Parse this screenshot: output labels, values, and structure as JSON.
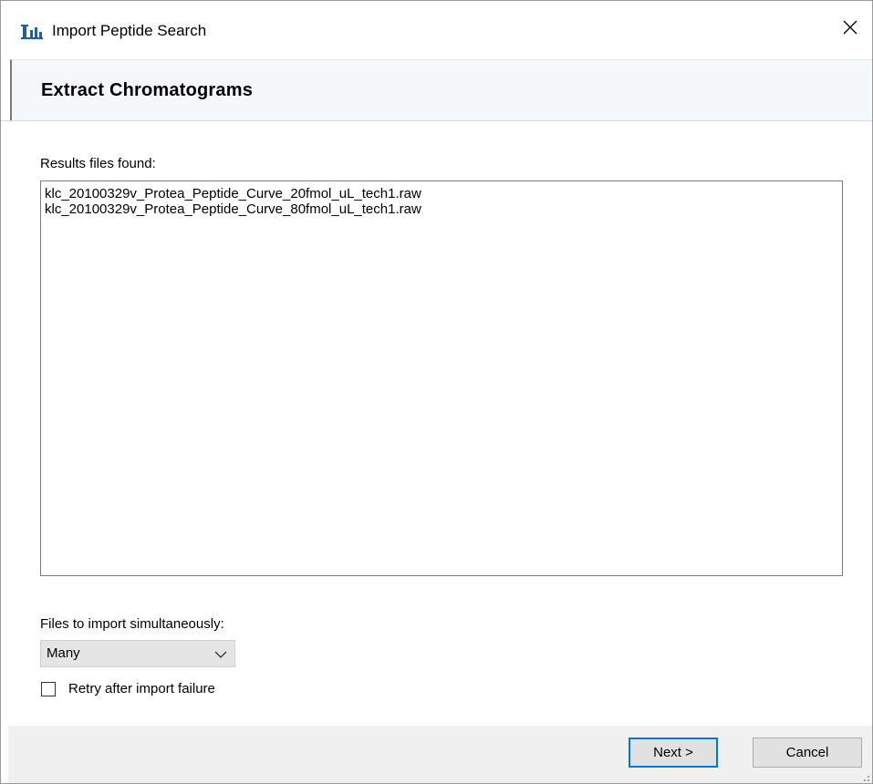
{
  "window": {
    "title": "Import Peptide Search",
    "icon": "bar-chart-app-icon",
    "close_icon": "close-icon"
  },
  "page": {
    "header_title": "Extract Chromatograms"
  },
  "results": {
    "label": "Results files found:",
    "files": [
      "klc_20100329v_Protea_Peptide_Curve_20fmol_uL_tech1.raw",
      "klc_20100329v_Protea_Peptide_Curve_80fmol_uL_tech1.raw"
    ]
  },
  "simultaneous": {
    "label": "Files to import simultaneously:",
    "selected": "Many"
  },
  "retry": {
    "label": "Retry after import failure",
    "checked": false
  },
  "buttons": {
    "next": "Next >",
    "cancel": "Cancel"
  },
  "colors": {
    "accent": "#0078d7",
    "icon_blue": "#1f5fa8"
  }
}
